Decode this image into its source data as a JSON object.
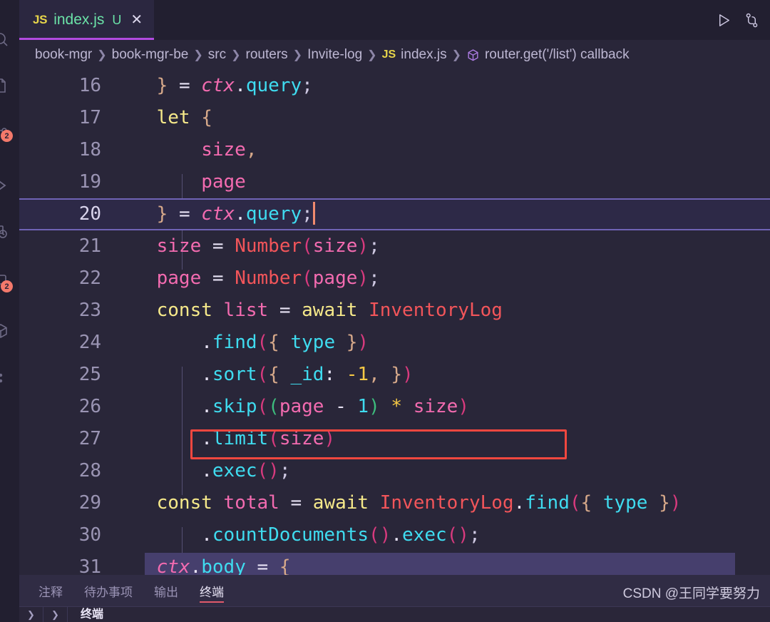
{
  "window": {
    "theme_background": "#292639",
    "accent": "#b14ae0"
  },
  "activity_bar": {
    "items": [
      {
        "icon": "search-icon",
        "badge": ""
      },
      {
        "icon": "files-explorer-icon",
        "badge": ""
      },
      {
        "icon": "source-control-icon",
        "badge": "2"
      },
      {
        "icon": "run-and-debug-icon",
        "badge": ""
      },
      {
        "icon": "extensions-icon",
        "badge": ""
      },
      {
        "icon": "remote-explorer-icon",
        "badge": ""
      },
      {
        "icon": "testing-icon",
        "badge": "2"
      },
      {
        "icon": "docker-icon",
        "badge": ""
      },
      {
        "icon": "more-icon",
        "badge": ""
      }
    ]
  },
  "tabs": {
    "items": [
      {
        "file_type": "JS",
        "label": "index.js",
        "dirty_badge": "U",
        "close_glyph": "✕",
        "active": true
      }
    ],
    "actions": [
      {
        "name": "run-code-button",
        "icon": "play-icon"
      },
      {
        "name": "split-source-control-button",
        "icon": "source-control-icon"
      }
    ]
  },
  "breadcrumbs": {
    "separator": "❯",
    "items": [
      {
        "label": "book-mgr",
        "icon": ""
      },
      {
        "label": "book-mgr-be",
        "icon": ""
      },
      {
        "label": "src",
        "icon": ""
      },
      {
        "label": "routers",
        "icon": ""
      },
      {
        "label": "Invite-log",
        "icon": ""
      },
      {
        "label": "index.js",
        "icon": "js-icon"
      },
      {
        "label": "router.get('/list') callback",
        "icon": "symbol-cube-icon"
      }
    ]
  },
  "editor": {
    "language": "javascript",
    "cursor_line": 20,
    "first_visible_line": 16,
    "last_visible_line": 31,
    "highlight_box": {
      "line": 25,
      "color": "#f2473f",
      "note": "red annotation rectangle around .sort({ _id: -1, })"
    },
    "lines": [
      {
        "num": "16",
        "text": "    } = ctx.query;"
      },
      {
        "num": "17",
        "text": "    let {"
      },
      {
        "num": "18",
        "text": "        size,"
      },
      {
        "num": "19",
        "text": "        page"
      },
      {
        "num": "20",
        "text": "    } = ctx.query;"
      },
      {
        "num": "21",
        "text": "    size = Number(size);"
      },
      {
        "num": "22",
        "text": "    page = Number(page);"
      },
      {
        "num": "23",
        "text": "    const list = await InventoryLog"
      },
      {
        "num": "24",
        "text": "        .find({ type })"
      },
      {
        "num": "25",
        "text": "        .sort({ _id: -1, })"
      },
      {
        "num": "26",
        "text": "        .skip((page - 1) * size)"
      },
      {
        "num": "27",
        "text": "        .limit(size)"
      },
      {
        "num": "28",
        "text": "        .exec();"
      },
      {
        "num": "29",
        "text": "    const total = await InventoryLog.find({ type })"
      },
      {
        "num": "30",
        "text": "        .countDocuments().exec();"
      },
      {
        "num": "31",
        "text": "    ctx.body = {"
      }
    ]
  },
  "panel": {
    "tabs": [
      {
        "label": "注释",
        "active": false
      },
      {
        "label": "待办事项",
        "active": false
      },
      {
        "label": "输出",
        "active": false
      },
      {
        "label": "终端",
        "active": true
      }
    ],
    "terminal_label": "终端",
    "chevron_glyph": "❯"
  },
  "watermark": {
    "text": "CSDN @王同学要努力"
  }
}
